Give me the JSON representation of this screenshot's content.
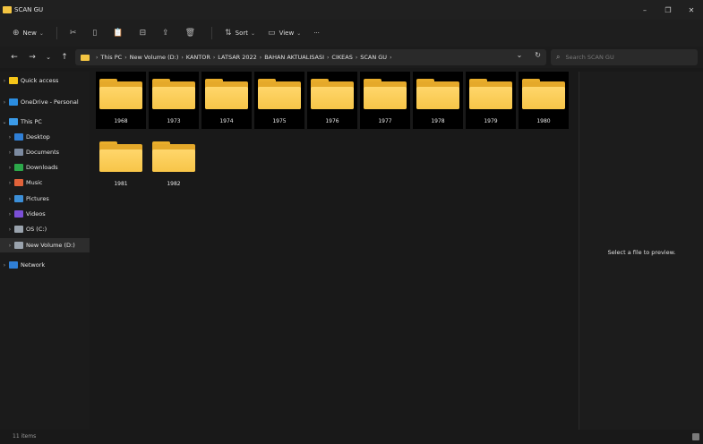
{
  "window": {
    "title": "SCAN GU",
    "minimize": "–",
    "maximize": "❐",
    "close": "✕"
  },
  "commandbar": {
    "new_label": "New",
    "new_icon": "⊕",
    "cut_icon": "✂",
    "copy_icon": "▯",
    "paste_icon": "📋",
    "rename_icon": "⊟",
    "share_icon": "⇪",
    "delete_icon": "🗑",
    "sort_label": "Sort",
    "sort_icon": "⇅",
    "view_label": "View",
    "view_icon": "▭",
    "more_label": "···",
    "caret": "⌄"
  },
  "navigation": {
    "back": "←",
    "forward": "→",
    "recent": "⌄",
    "up": "↑"
  },
  "address": {
    "crumbs": [
      "This PC",
      "New Volume (D:)",
      "KANTOR",
      "LATSAR 2022",
      "BAHAN AKTUALISASI",
      "CIKEAS",
      "SCAN GU"
    ],
    "separator": "›",
    "dropdown": "⌄",
    "refresh": "↻"
  },
  "search": {
    "placeholder": "Search SCAN GU",
    "icon": "⌕"
  },
  "sidebar": {
    "items": [
      {
        "label": "Quick access",
        "chevron": "›",
        "color": "#f5c518"
      },
      {
        "label": "OneDrive - Personal",
        "chevron": "›",
        "color": "#2b8de0"
      },
      {
        "label": "This PC",
        "chevron": "⌄",
        "color": "#3b9be8"
      },
      {
        "label": "Desktop",
        "chevron": "›",
        "color": "#2f7fd6"
      },
      {
        "label": "Documents",
        "chevron": "›",
        "color": "#7c8aa0"
      },
      {
        "label": "Downloads",
        "chevron": "›",
        "color": "#2ca84a"
      },
      {
        "label": "Music",
        "chevron": "›",
        "color": "#e0623a"
      },
      {
        "label": "Pictures",
        "chevron": "›",
        "color": "#3c8fd8"
      },
      {
        "label": "Videos",
        "chevron": "›",
        "color": "#7b4fd6"
      },
      {
        "label": "OS (C:)",
        "chevron": "›",
        "color": "#9aa3ad"
      },
      {
        "label": "New Volume (D:)",
        "chevron": "›",
        "color": "#9aa3ad"
      },
      {
        "label": "Network",
        "chevron": "›",
        "color": "#2f7fd6"
      }
    ]
  },
  "folders": [
    {
      "name": "1968"
    },
    {
      "name": "1973"
    },
    {
      "name": "1974"
    },
    {
      "name": "1975"
    },
    {
      "name": "1976"
    },
    {
      "name": "1977"
    },
    {
      "name": "1978"
    },
    {
      "name": "1979"
    },
    {
      "name": "1980"
    },
    {
      "name": "1981"
    },
    {
      "name": "1982"
    }
  ],
  "preview": {
    "message": "Select a file to preview."
  },
  "status": {
    "item_count": "11 items"
  }
}
